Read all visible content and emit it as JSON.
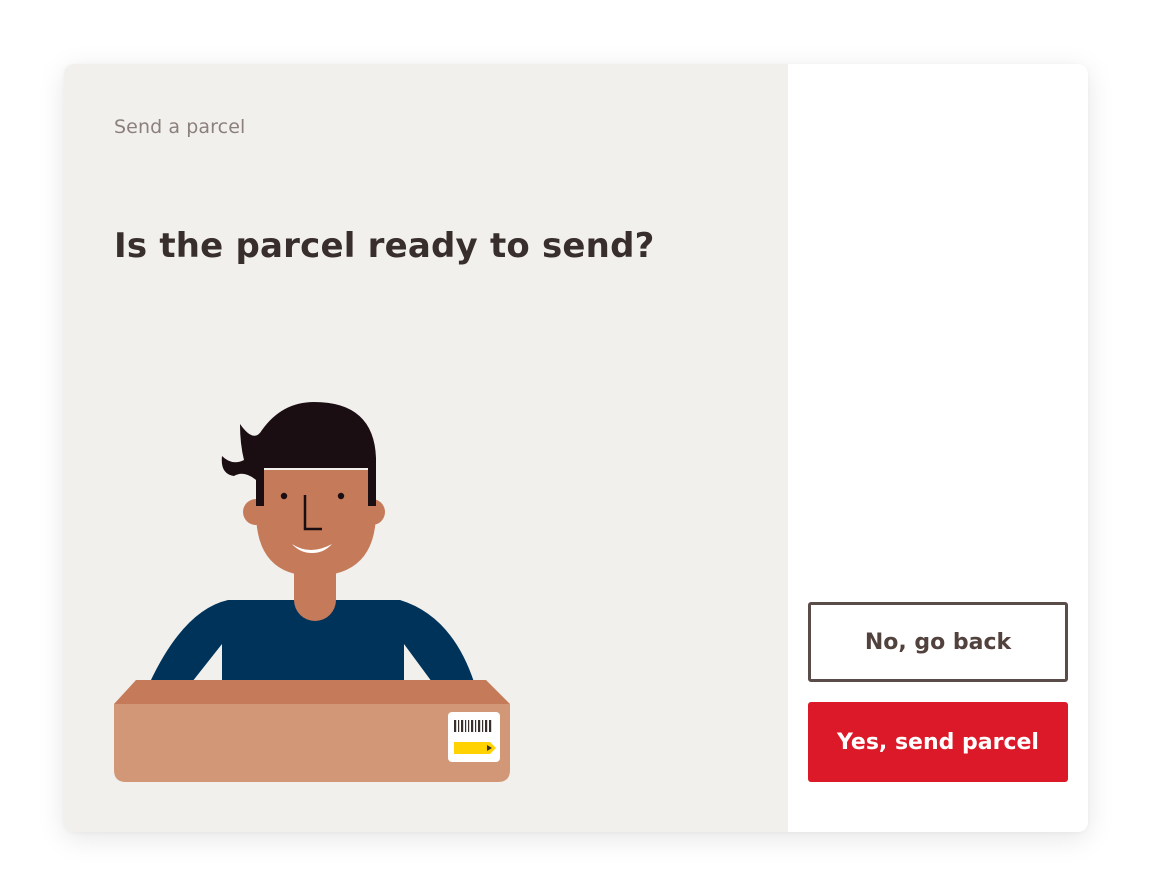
{
  "header": {
    "eyebrow": "Send a parcel",
    "question": "Is the parcel ready to send?"
  },
  "actions": {
    "back_label": "No, go back",
    "confirm_label": "Yes, send parcel"
  },
  "illustration": {
    "subject": "person-holding-parcel",
    "label_icon": "barcode-label-icon"
  },
  "colors": {
    "panel_bg": "#f1f0ed",
    "heading_text": "#382e2c",
    "eyebrow_text": "#8c807c",
    "primary": "#dc1928",
    "secondary_border": "#5a4c48",
    "label_yellow": "#ffd200",
    "shirt": "#00335a",
    "skin": "#c57b59",
    "box": "#d29777"
  }
}
